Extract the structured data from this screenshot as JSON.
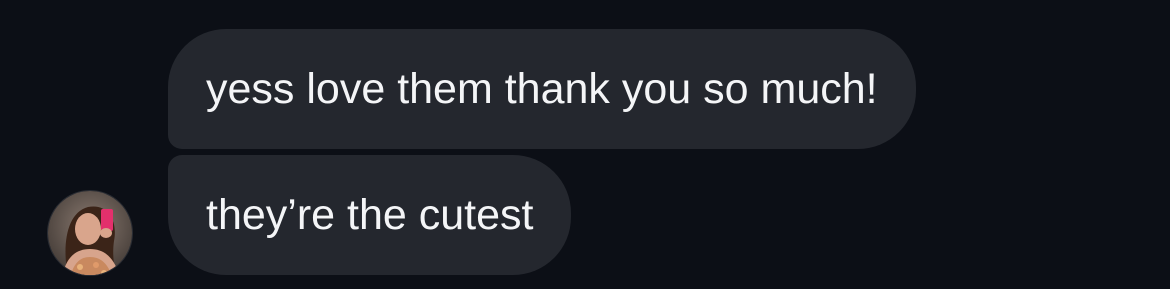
{
  "conversation": {
    "messages": [
      {
        "text": "yess love them thank you so much!"
      },
      {
        "text": "they’re the cutest"
      }
    ]
  },
  "theme": {
    "background": "#0c0f16",
    "bubble": "#24272e",
    "text": "#f4f5f7"
  }
}
